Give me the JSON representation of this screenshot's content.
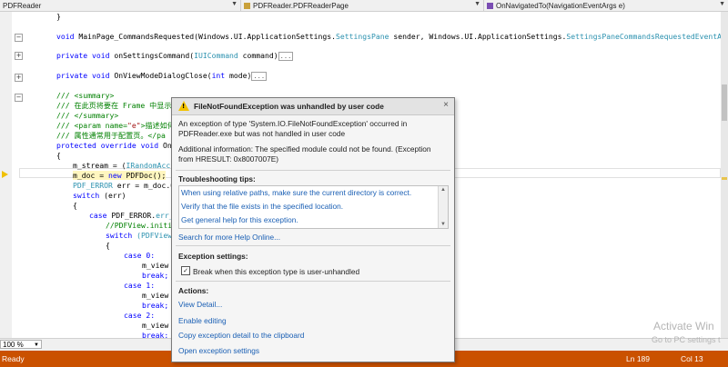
{
  "nav": {
    "project": "PDFReader",
    "class": "PDFReader.PDFReaderPage",
    "member": "OnNavigatedTo(NavigationEventArgs e)"
  },
  "code": {
    "brace_close": "}",
    "l1_void": "void",
    "l1_rest": " MainPage_CommandsRequested(Windows.UI.ApplicationSettings.",
    "l1_type": "SettingsPane",
    "l1_rest2": " sender, Windows.UI.ApplicationSettings.",
    "l1_type2": "SettingsPaneCommandsRequestedEventArgs",
    "l2_kw": "private void",
    "l2_rest": " onSettingsCommand(",
    "l2_type": "IUICommand",
    "l2_rest2": " command)",
    "collapsed": "...",
    "l3_kw": "private void",
    "l3_rest": " OnViewModeDialogClose(",
    "l3_int": "int",
    "l3_rest2": " mode)",
    "doc1": "/// <summary>",
    "doc2": "/// 在此页将要在 Frame 中显示",
    "doc3": "/// </summary>",
    "doc4a": "/// <param name=",
    "doc4b": "\"e\"",
    "doc4c": ">描述如何",
    "doc5": "/// 属性通常用于配置页。</pa",
    "sig_kw": "protected override void",
    "sig_rest": " OnN",
    "brace_open": "{",
    "s1a": "m_stream = (",
    "s1b": "IRandomAcc",
    "s2a": "m_doc = ",
    "s2b": "new",
    "s2c": " PDFDoc();",
    "s3a": "PDF_ERROR",
    "s3b": " err = m_doc.O",
    "s4a": "switch",
    "s4b": " (err)",
    "s6a": "case",
    "s6b": " PDF_ERROR.",
    "s6c": "err_",
    "s7": "//PDFView.initi",
    "s8a": "switch",
    "s8b": " (PDFView",
    "case0": "case 0:",
    "case1": "case 1:",
    "case2": "case 2:",
    "mview": "m_view",
    "brk": "break;"
  },
  "zoom": "100 %",
  "status": {
    "ready": "Ready",
    "ln": "Ln 189",
    "col": "Col 13"
  },
  "watermark": {
    "line1": "Activate Win",
    "line2": "Go to PC settings t"
  },
  "exception": {
    "title": "FileNotFoundException was unhandled by user code",
    "desc": "An exception of type 'System.IO.FileNotFoundException' occurred in PDFReader.exe but was not handled in user code",
    "info": "Additional information: The specified module could not be found. (Exception from HRESULT: 0x8007007E)",
    "tips_header": "Troubleshooting tips:",
    "tips": [
      "When using relative paths, make sure the current directory is correct.",
      "Verify that the file exists in the specified location.",
      "Get general help for this exception."
    ],
    "search_help": "Search for more Help Online...",
    "settings_header": "Exception settings:",
    "break_label": "Break when this exception type is user-unhandled",
    "break_checked": true,
    "actions_header": "Actions:",
    "actions": [
      "View Detail...",
      "Enable editing",
      "Copy exception detail to the clipboard",
      "Open exception settings"
    ]
  },
  "colors": {
    "status_bar": "#ca5100",
    "link": "#1a5fb4",
    "keyword": "#0000ff",
    "type": "#2b91af",
    "comment": "#008000",
    "warning": "#f2c200"
  }
}
